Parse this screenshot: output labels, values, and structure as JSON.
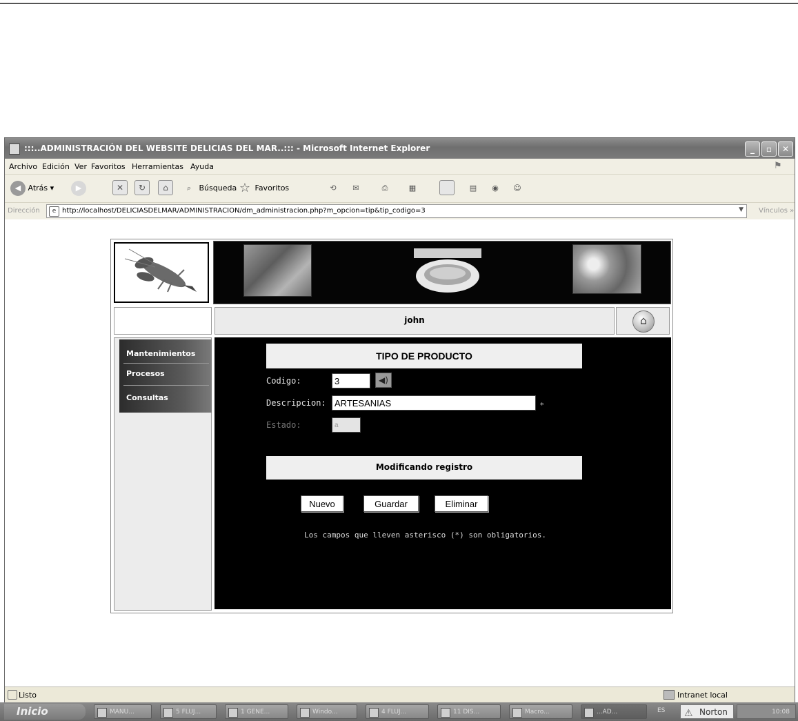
{
  "window": {
    "title": ":::..ADMINISTRACIÓN DEL WEBSITE DELICIAS DEL MAR..::: - Microsoft Internet Explorer",
    "controls": [
      "_",
      "▫",
      "✕"
    ]
  },
  "menu": [
    "Archivo",
    "Edición",
    "Ver",
    "Favoritos",
    "Herramientas",
    "Ayuda"
  ],
  "toolbar": {
    "back_label": "Atrás",
    "search_label": "Búsqueda",
    "favorites_label": "Favoritos"
  },
  "address": {
    "label": "Dirección",
    "url": "http://localhost/DELICIASDELMAR/ADMINISTRACION/dm_administracion.php?m_opcion=tip&tip_codigo=3",
    "links_label": "Vínculos"
  },
  "page": {
    "user": "john",
    "nav": [
      "Mantenimientos",
      "Procesos",
      "Consultas"
    ],
    "form": {
      "title": "TIPO DE PRODUCTO",
      "codigo_label": "Codigo:",
      "codigo_value": "3",
      "descripcion_label": "Descripcion:",
      "descripcion_value": "ARTESANIAS",
      "required_mark": "*",
      "estado_label": "Estado:",
      "estado_value": "a",
      "status_message": "Modificando registro",
      "buttons": {
        "nuevo": "Nuevo",
        "guardar": "Guardar",
        "eliminar": "Eliminar"
      },
      "note": "Los campos que lleven asterisco (*) son obligatorios."
    }
  },
  "status": {
    "left": "Listo",
    "right": "Intranet local"
  },
  "taskbar": {
    "start": "Inicio",
    "tasks": [
      "MANU...",
      "5 FLUJ...",
      "1 GENE...",
      "Windo...",
      "4 FLUJ...",
      "11 DIS...",
      "Macro...",
      "...AD..."
    ],
    "lang": "ES",
    "norton": "Norton",
    "time": "10:08"
  },
  "icons": [
    "back-icon",
    "forward-icon",
    "stop-icon",
    "refresh-icon",
    "home-icon",
    "search-icon",
    "favorites-star-icon",
    "history-icon",
    "mail-icon",
    "print-icon",
    "speaker-icon"
  ]
}
